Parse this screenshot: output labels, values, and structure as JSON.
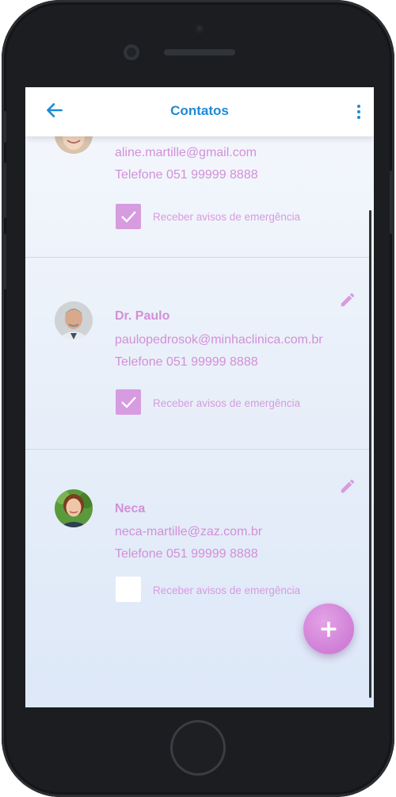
{
  "appbar": {
    "title": "Contatos"
  },
  "contacts": [
    {
      "name": "",
      "email": "aline.martille@gmail.com",
      "phone": "Telefone 051 99999 8888",
      "emergency_label": "Receber avisos de emergência",
      "emergency_checked": true
    },
    {
      "name": "Dr. Paulo",
      "email": "paulopedrosok@minhaclinica.com.br",
      "phone": "Telefone 051 99999 8888",
      "emergency_label": "Receber avisos de emergência",
      "emergency_checked": true
    },
    {
      "name": "Neca",
      "email": "neca-martille@zaz.com.br",
      "phone": "Telefone 051 99999 8888",
      "emergency_label": "Receber avisos de emergência",
      "emergency_checked": false
    }
  ],
  "fab": {
    "label": "+"
  },
  "icons": {
    "back": "arrow-left-icon",
    "more": "more-vertical-icon",
    "edit": "pencil-icon",
    "check": "checkmark-icon"
  },
  "colors": {
    "accent": "#1e8ad6",
    "contact_text": "#d38fd8",
    "checkbox": "#d79be0"
  }
}
